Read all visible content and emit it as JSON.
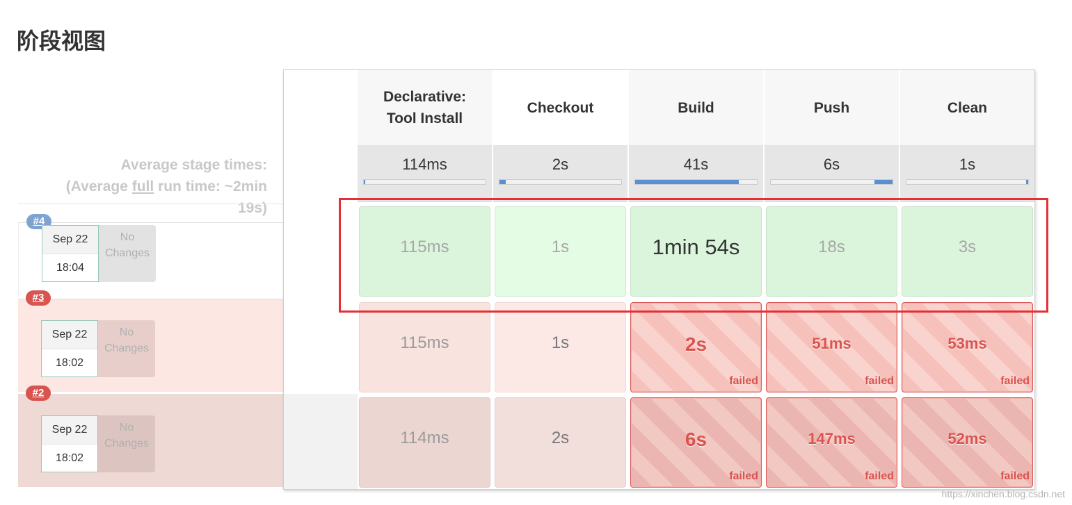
{
  "page_title": "阶段视图",
  "average": {
    "line1": "Average stage times:",
    "line2_pre": "(Average ",
    "line2_full": "full",
    "line2_post": " run time: ~2min",
    "line3": "19s)"
  },
  "stages": [
    "Declarative: Tool Install",
    "Checkout",
    "Build",
    "Push",
    "Clean"
  ],
  "stage_header_lines": [
    [
      "Declarative:",
      "Tool Install"
    ],
    [
      "Checkout"
    ],
    [
      "Build"
    ],
    [
      "Push"
    ],
    [
      "Clean"
    ]
  ],
  "avg_times": [
    "114ms",
    "2s",
    "41s",
    "6s",
    "1s"
  ],
  "avg_bar_fraction": [
    0.0,
    0.05,
    0.85,
    0.15,
    0.02
  ],
  "runs": [
    {
      "badge": "#4",
      "date": "Sep 22",
      "time": "18:04",
      "changes": "No Changes",
      "status": "success",
      "cells": [
        {
          "value": "115ms",
          "failed": false
        },
        {
          "value": "1s",
          "failed": false
        },
        {
          "value": "1min 54s",
          "failed": false
        },
        {
          "value": "18s",
          "failed": false
        },
        {
          "value": "3s",
          "failed": false
        }
      ]
    },
    {
      "badge": "#3",
      "date": "Sep 22",
      "time": "18:02",
      "changes": "No Changes",
      "status": "failed",
      "cells": [
        {
          "value": "115ms",
          "failed": false
        },
        {
          "value": "1s",
          "failed": false
        },
        {
          "value": "2s",
          "failed": true
        },
        {
          "value": "51ms",
          "failed": true
        },
        {
          "value": "53ms",
          "failed": true
        }
      ]
    },
    {
      "badge": "#2",
      "date": "Sep 22",
      "time": "18:02",
      "changes": "No Changes",
      "status": "failed",
      "cells": [
        {
          "value": "114ms",
          "failed": false
        },
        {
          "value": "2s",
          "failed": false
        },
        {
          "value": "6s",
          "failed": true
        },
        {
          "value": "147ms",
          "failed": true
        },
        {
          "value": "52ms",
          "failed": true
        }
      ]
    }
  ],
  "failed_label": "failed",
  "watermark": "https://xinchen.blog.csdn.net",
  "colors": {
    "success": "#dbf5dc",
    "failed_stripe": "#f6c1bb",
    "failed_text": "#d9534f",
    "highlight": "#e52f36",
    "badge_success": "#7fa3d1",
    "badge_failed": "#d9534f"
  }
}
